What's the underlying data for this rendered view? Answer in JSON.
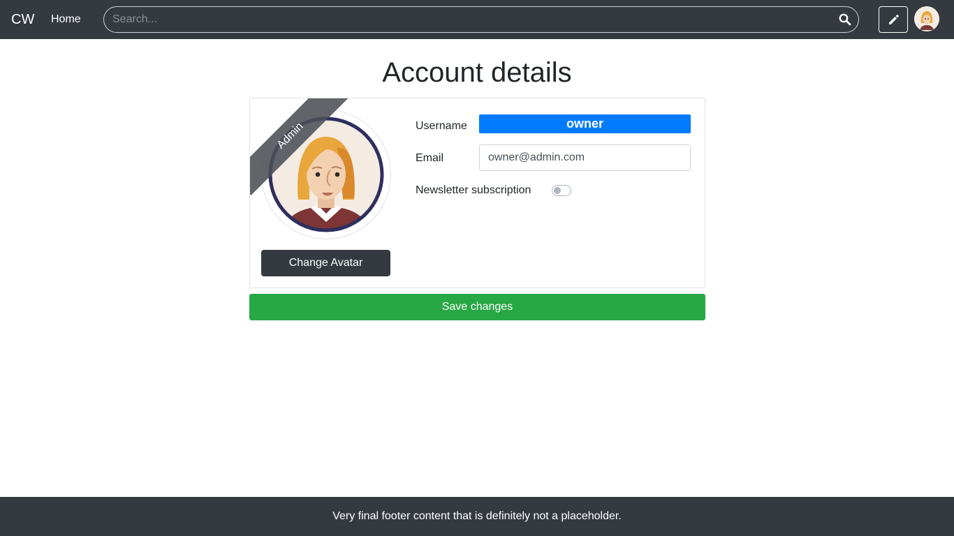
{
  "navbar": {
    "brand": "CW",
    "home_label": "Home",
    "search_placeholder": "Search..."
  },
  "page": {
    "title": "Account details"
  },
  "profile": {
    "role_ribbon": "Admin",
    "change_avatar_label": "Change Avatar",
    "username_label": "Username",
    "username_value": "owner",
    "email_label": "Email",
    "email_value": "owner@admin.com",
    "newsletter_label": "Newsletter subscription",
    "newsletter_enabled": false
  },
  "actions": {
    "save_label": "Save changes"
  },
  "footer": {
    "text": "Very final footer content that is definitely not a placeholder."
  },
  "colors": {
    "navbar_bg": "#343a40",
    "primary": "#007bff",
    "success": "#28a745"
  }
}
